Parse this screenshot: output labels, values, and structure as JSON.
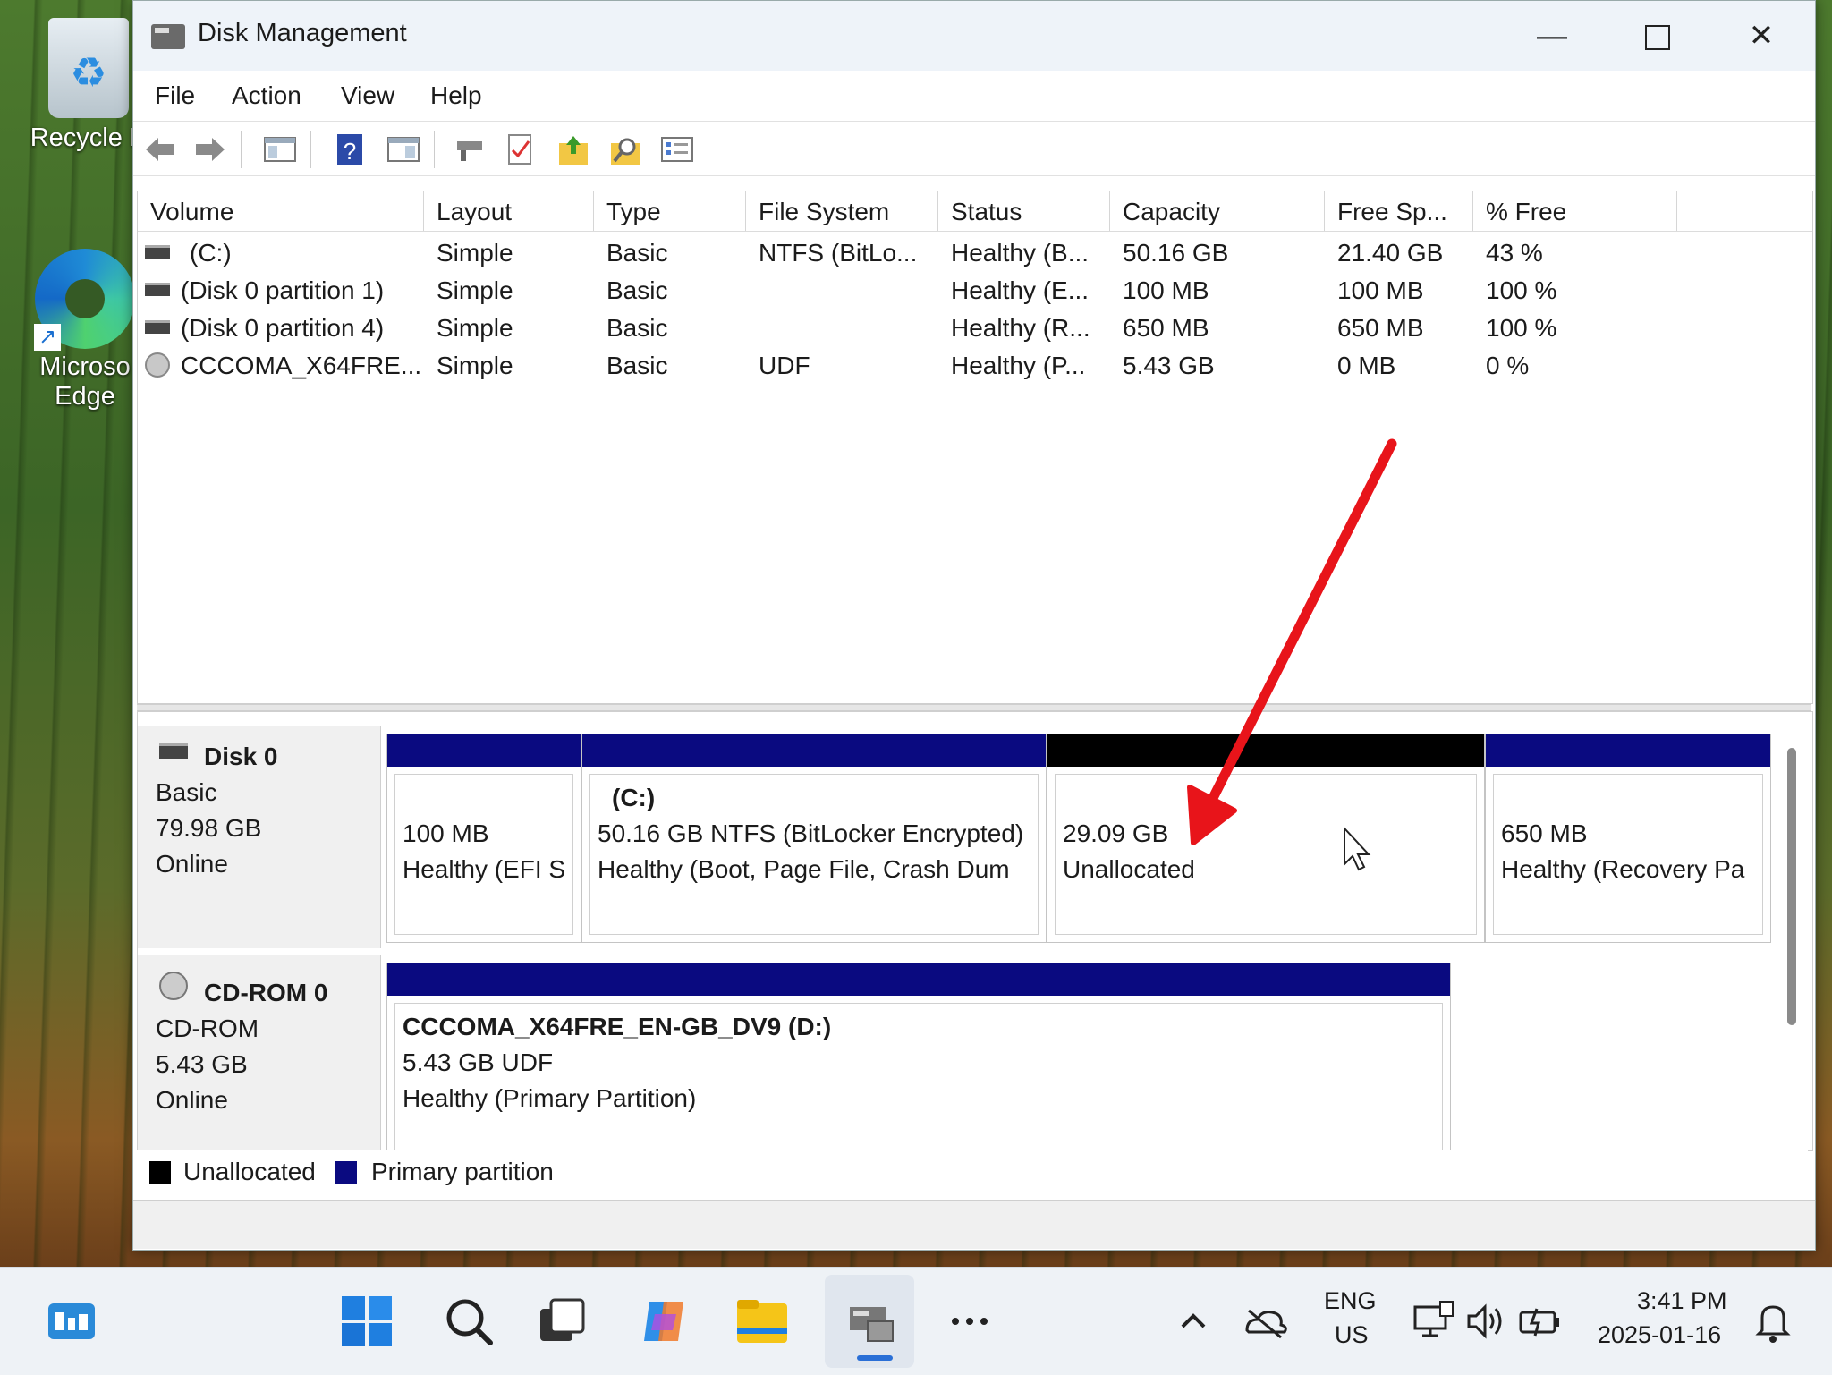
{
  "desktop": {
    "icons": [
      {
        "label": "Recycle B",
        "icon": "recycle-bin-icon"
      },
      {
        "label": "Microsoft Edge",
        "line1": "Microso",
        "line2": "Edge",
        "icon": "edge-icon"
      }
    ]
  },
  "window": {
    "title": "Disk Management",
    "controls": {
      "minimize": "—",
      "close": "✕"
    }
  },
  "menu": [
    "File",
    "Action",
    "View",
    "Help"
  ],
  "toolbar": {
    "icons": [
      "back-arrow-icon",
      "forward-arrow-icon",
      "console-tree-icon",
      "help-icon",
      "show-pane-icon",
      "connect-icon",
      "properties-icon",
      "export-icon",
      "search-icon",
      "settings-icon"
    ]
  },
  "volume_list": {
    "columns": [
      "Volume",
      "Layout",
      "Type",
      "File System",
      "Status",
      "Capacity",
      "Free Sp...",
      "% Free"
    ],
    "rows": [
      {
        "volume": "(C:)",
        "layout": "Simple",
        "type": "Basic",
        "fs": "NTFS (BitLo...",
        "status": "Healthy (B...",
        "capacity": "50.16 GB",
        "free": "21.40 GB",
        "pct": "43 %",
        "icon": "hdd-icon"
      },
      {
        "volume": "(Disk 0 partition 1)",
        "layout": "Simple",
        "type": "Basic",
        "fs": "",
        "status": "Healthy (E...",
        "capacity": "100 MB",
        "free": "100 MB",
        "pct": "100 %",
        "icon": "hdd-icon"
      },
      {
        "volume": "(Disk 0 partition 4)",
        "layout": "Simple",
        "type": "Basic",
        "fs": "",
        "status": "Healthy (R...",
        "capacity": "650 MB",
        "free": "650 MB",
        "pct": "100 %",
        "icon": "hdd-icon"
      },
      {
        "volume": "CCCOMA_X64FRE...",
        "layout": "Simple",
        "type": "Basic",
        "fs": "UDF",
        "status": "Healthy (P...",
        "capacity": "5.43 GB",
        "free": "0 MB",
        "pct": "0 %",
        "icon": "cdrom-icon"
      }
    ]
  },
  "disks": [
    {
      "name": "Disk 0",
      "kind": "Basic",
      "size": "79.98 GB",
      "state": "Online",
      "partitions": [
        {
          "l1": "",
          "l2": "100 MB",
          "l3": "Healthy (EFI S",
          "bar": "#0a0a80"
        },
        {
          "l1": "(C:)",
          "l2": "50.16 GB NTFS (BitLocker Encrypted)",
          "l3": "Healthy (Boot, Page File, Crash Dum",
          "bar": "#0a0a80"
        },
        {
          "l1": "",
          "l2": "29.09 GB",
          "l3": "Unallocated",
          "bar": "#000000"
        },
        {
          "l1": "",
          "l2": "650 MB",
          "l3": "Healthy (Recovery Pa",
          "bar": "#0a0a80"
        }
      ]
    },
    {
      "name": "CD-ROM 0",
      "kind": "CD-ROM",
      "size": "5.43 GB",
      "state": "Online",
      "partitions": [
        {
          "l1": "CCCOMA_X64FRE_EN-GB_DV9  (D:)",
          "l2": "5.43 GB UDF",
          "l3": "Healthy (Primary Partition)",
          "bar": "#0a0a80"
        }
      ]
    }
  ],
  "legend": [
    {
      "label": "Unallocated",
      "color": "#000000"
    },
    {
      "label": "Primary partition",
      "color": "#0a0a80"
    }
  ],
  "colors": {
    "primary_partition": "#0a0a80",
    "unallocated": "#000000",
    "annotation_arrow": "#e8141a"
  },
  "taskbar": {
    "apps": [
      "widgets-icon",
      "start-icon",
      "search-icon",
      "task-view-icon",
      "copilot-icon",
      "file-explorer-icon",
      "disk-management-icon",
      "more-icon"
    ],
    "tray": {
      "lang1": "ENG",
      "lang2": "US",
      "time": "3:41 PM",
      "date": "2025-01-16"
    }
  }
}
